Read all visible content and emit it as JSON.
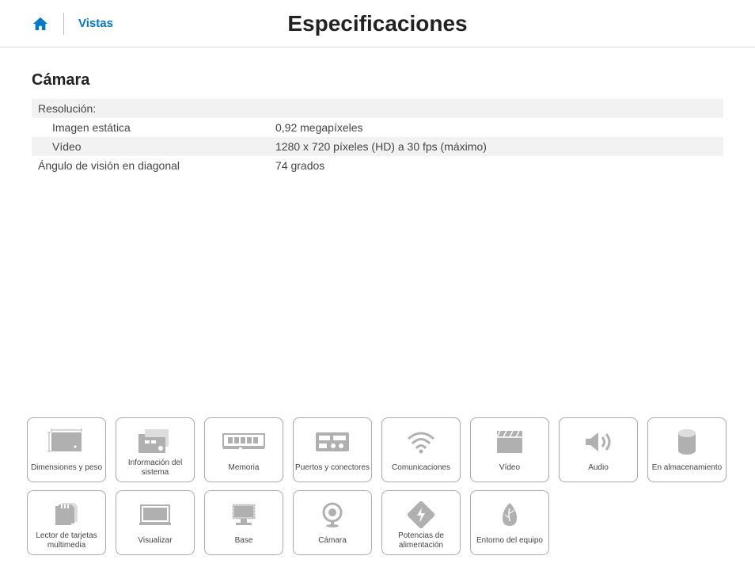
{
  "header": {
    "vistas": "Vistas",
    "title": "Especificaciones"
  },
  "section": {
    "title": "Cámara",
    "rows": [
      {
        "label": "Resolución:",
        "value": "",
        "gray": true,
        "indent": false
      },
      {
        "label": "Imagen estática",
        "value": "0,92 megapíxeles",
        "gray": false,
        "indent": true
      },
      {
        "label": "Vídeo",
        "value": "1280 x 720 píxeles (HD) a 30 fps (máximo)",
        "gray": true,
        "indent": true
      },
      {
        "label": "Ángulo de visión en diagonal",
        "value": "74 grados",
        "gray": false,
        "indent": false
      }
    ]
  },
  "nav": {
    "row1": [
      {
        "id": "dimensions",
        "label": "Dimensiones y peso"
      },
      {
        "id": "sysinfo",
        "label": "Información del sistema"
      },
      {
        "id": "memory",
        "label": "Memoria"
      },
      {
        "id": "ports",
        "label": "Puertos y conectores"
      },
      {
        "id": "comm",
        "label": "Comunicaciones"
      },
      {
        "id": "video",
        "label": "Vídeo"
      },
      {
        "id": "audio",
        "label": "Audio"
      },
      {
        "id": "storage",
        "label": "En almacenamiento"
      }
    ],
    "row2": [
      {
        "id": "cardreader",
        "label": "Lector de tarjetas multimedia"
      },
      {
        "id": "display",
        "label": "Visualizar"
      },
      {
        "id": "base",
        "label": "Base"
      },
      {
        "id": "camera",
        "label": "Cámara"
      },
      {
        "id": "power",
        "label": "Potencias de alimentación"
      },
      {
        "id": "environment",
        "label": "Entorno del equipo"
      }
    ]
  }
}
